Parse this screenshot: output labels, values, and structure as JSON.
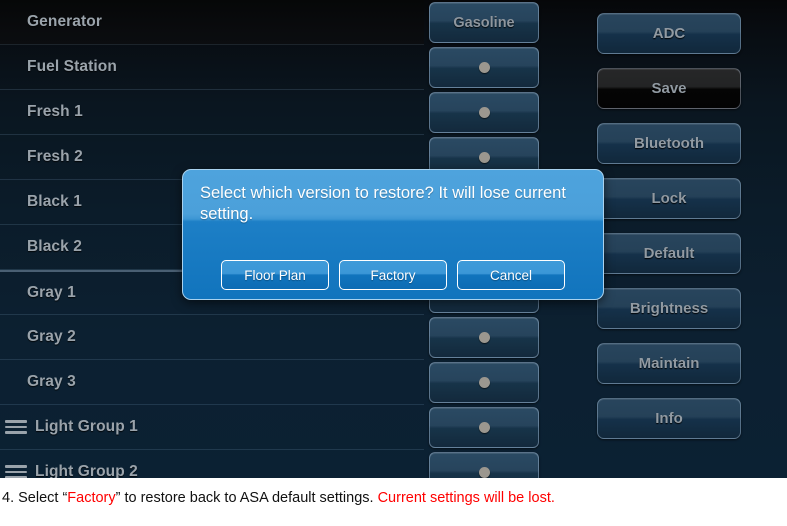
{
  "device": {
    "list": {
      "rows": [
        {
          "label": "Generator",
          "icon": "none",
          "control": "text",
          "control_label": "Gasoline",
          "first": true
        },
        {
          "label": "Fuel Station",
          "icon": "none",
          "control": "dot",
          "control_label": ""
        },
        {
          "label": "Fresh 1",
          "icon": "none",
          "control": "dot",
          "control_label": ""
        },
        {
          "label": "Fresh 2",
          "icon": "none",
          "control": "dot",
          "control_label": ""
        },
        {
          "label": "Black 1",
          "icon": "none",
          "control": "dot",
          "control_label": ""
        },
        {
          "label": "Black 2",
          "icon": "none",
          "control": "dot",
          "control_label": ""
        },
        {
          "label": "Gray 1",
          "icon": "none",
          "control": "dot",
          "control_label": "",
          "separator": true
        },
        {
          "label": "Gray 2",
          "icon": "none",
          "control": "dot",
          "control_label": ""
        },
        {
          "label": "Gray 3",
          "icon": "none",
          "control": "dot",
          "control_label": ""
        },
        {
          "label": "Light Group 1",
          "icon": "hamburger-icon",
          "control": "dot",
          "control_label": ""
        },
        {
          "label": "Light Group 2",
          "icon": "hamburger-icon",
          "control": "dot",
          "control_label": ""
        }
      ]
    },
    "sidebar": {
      "buttons": [
        {
          "label": "ADC",
          "state": "normal"
        },
        {
          "label": "Save",
          "state": "selected"
        },
        {
          "label": "Bluetooth",
          "state": "normal"
        },
        {
          "label": "Lock",
          "state": "normal"
        },
        {
          "label": "Default",
          "state": "normal"
        },
        {
          "label": "Brightness",
          "state": "normal"
        },
        {
          "label": "Maintain",
          "state": "normal"
        },
        {
          "label": "Info",
          "state": "normal"
        }
      ]
    },
    "dialog": {
      "message": "Select which version to restore? It will lose current setting.",
      "buttons": [
        {
          "label": "Floor Plan"
        },
        {
          "label": "Factory"
        },
        {
          "label": "Cancel"
        }
      ]
    }
  },
  "caption": {
    "part1": "4. Select “",
    "highlight1": "Factory",
    "part2": "” to restore back to ASA default settings. ",
    "highlight2": "Current settings will be lost."
  },
  "colors": {
    "dialog_blue": "#1d7fc6",
    "dialog_blue_light": "#4ea3dd",
    "button_blue": "#27445c",
    "label_gray": "#9aa3ab",
    "warning_red": "#ff0000",
    "screen_bg_top": "#060709",
    "screen_bg_bottom": "#0b2133"
  }
}
